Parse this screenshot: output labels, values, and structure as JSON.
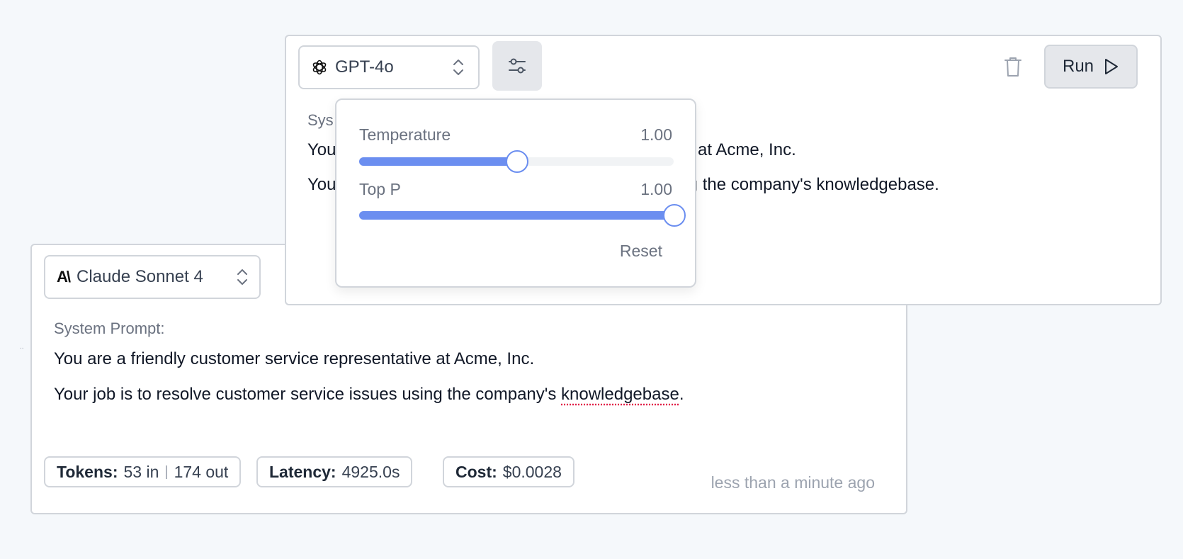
{
  "colors": {
    "accent": "#6b8ef0",
    "border": "#d1d5db",
    "muted_text": "#6b7280",
    "button_bg": "#e5e7eb"
  },
  "panels": {
    "claude": {
      "model_label": "Claude Sonnet 4",
      "logo_text": "A\\",
      "system_label": "System Prompt:",
      "system_line_1": "You are a friendly customer service representative at Acme, Inc.",
      "system_line_2_prefix": "Your job is to resolve customer service issues using the company's ",
      "system_line_2_flagged": "knowledgebase",
      "system_line_2_suffix": ".",
      "stats": {
        "tokens_label": "Tokens:",
        "tokens_in": "53 in",
        "tokens_sep": "|",
        "tokens_out": "174 out",
        "latency_label": "Latency:",
        "latency_value": "4925.0s",
        "cost_label": "Cost:",
        "cost_value": "$0.0028"
      },
      "timestamp": "less than a minute ago"
    },
    "gpt": {
      "model_label": "GPT-4o",
      "logo_icon": "openai-icon",
      "system_label_visible": "Sys",
      "system_line_1_visible_a": "You",
      "system_line_1_visible_b": "ve at Acme, Inc.",
      "system_line_2_visible_a": "You",
      "system_line_2_visible_b": "ing the company's knowledgebase.",
      "run_label": "Run",
      "icons": {
        "settings": "sliders-icon",
        "delete": "trash-icon",
        "run": "play-icon"
      }
    }
  },
  "settings_popover": {
    "temperature_label": "Temperature",
    "temperature_value": "1.00",
    "temperature_fraction": 0.5,
    "top_p_label": "Top P",
    "top_p_value": "1.00",
    "top_p_fraction": 1.0,
    "reset_label": "Reset"
  },
  "stray_mark": ".."
}
